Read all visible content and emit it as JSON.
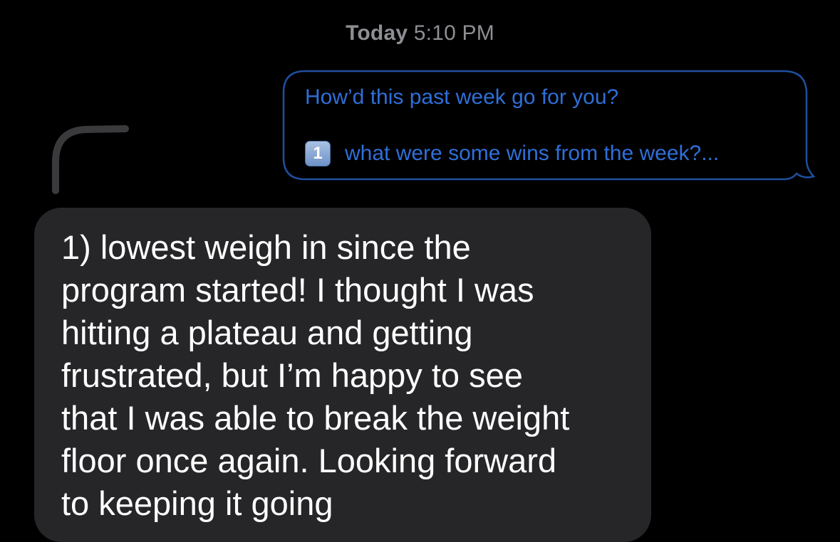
{
  "timestamp": {
    "day": "Today",
    "time": "5:10 PM"
  },
  "sent_message": {
    "line1": "How’d this past week go for you?",
    "keycap": "1",
    "line2": "what were some wins from the week?..."
  },
  "received_message": {
    "lines": [
      "1) lowest weigh in since the",
      "program started! I thought I was",
      "hitting a plateau and getting",
      "frustrated, but I’m happy to see",
      "that I was able to break the weight",
      "floor once again. Looking forward",
      "to keeping it going"
    ]
  },
  "colors": {
    "background": "#000000",
    "sent_text": "#2f6fd8",
    "sent_border": "#1e4f9e",
    "received_bubble": "#262628",
    "received_text": "#ffffff",
    "timestamp": "#8e8e93"
  }
}
